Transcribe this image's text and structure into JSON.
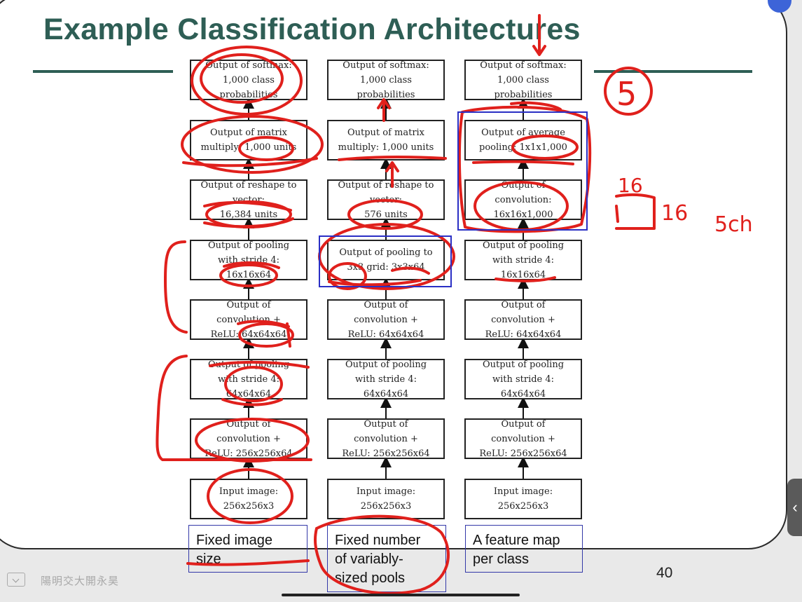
{
  "slide": {
    "title": "Example Classification Architectures",
    "page_number": "40",
    "watermark": "陽明交大開永昊"
  },
  "columns": [
    {
      "boxes": [
        "Output of softmax:\n1,000 class\nprobabilities",
        "Output of matrix\nmultiply: 1,000 units",
        "Output of reshape to\nvector:\n16,384 units",
        "Output of pooling\nwith stride 4:\n16x16x64",
        "Output of\nconvolution +\nReLU: 64x64x64",
        "Output of pooling\nwith stride 4:\n64x64x64",
        "Output of\nconvolution +\nReLU: 256x256x64",
        "Input image:\n256x256x3"
      ],
      "caption": "Fixed image\nsize"
    },
    {
      "boxes": [
        "Output of softmax:\n1,000 class\nprobabilities",
        "Output of matrix\nmultiply: 1,000 units",
        "Output of reshape to\nvector:\n576 units",
        "Output of pooling to\n3x3 grid: 3x3x64",
        "Output of\nconvolution +\nReLU: 64x64x64",
        "Output of pooling\nwith stride 4:\n64x64x64",
        "Output of\nconvolution +\nReLU: 256x256x64",
        "Input image:\n256x256x3"
      ],
      "caption": "Fixed number\nof variably-\nsized pools"
    },
    {
      "boxes": [
        "Output of softmax:\n1,000 class\nprobabilities",
        "Output of average\npooling: 1x1x1,000",
        "Output of\nconvolution:\n16x16x1,000",
        "Output of pooling\nwith stride 4:\n16x16x64",
        "Output of\nconvolution +\nReLU: 64x64x64",
        "Output of pooling\nwith stride 4:\n64x64x64",
        "Output of\nconvolution +\nReLU: 256x256x64",
        "Input image:\n256x256x3"
      ],
      "caption": "A feature map\nper class"
    }
  ],
  "annotations": {
    "circled_number": "5",
    "note_16": "16",
    "note_16b": "16",
    "note_5ch": "5ch",
    "ink_color": "#e0201c",
    "highlight_box_color": "#2a2fc4"
  },
  "colors": {
    "title": "#2e5e55",
    "caption_border": "#3338a8"
  },
  "controls": {
    "scroll_handle_icon": "chevron-left-icon"
  }
}
